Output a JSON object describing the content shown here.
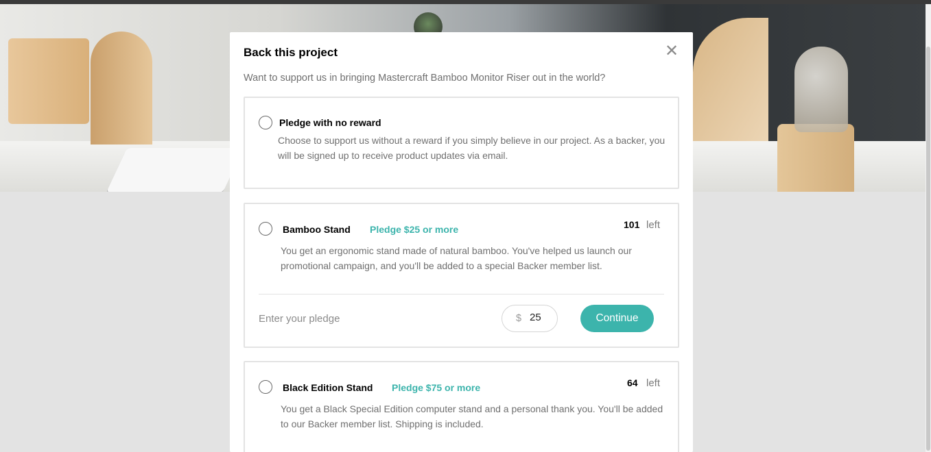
{
  "modal": {
    "title": "Back this project",
    "subtitle": "Want to support us in bringing Mastercraft Bamboo Monitor Riser out in the world?",
    "close_icon": "close-icon"
  },
  "rewards": [
    {
      "title": "Pledge with no reward",
      "description": "Choose to support us without a reward if you simply believe in our project. As a backer, you will be signed up to receive product updates via email.",
      "selected": false
    },
    {
      "title": "Bamboo Stand",
      "pledge_min": "Pledge $25 or more",
      "left_count": "101",
      "left_word": "left",
      "description": "You get an ergonomic stand made of natural bamboo. You've helped us launch our promotional campaign, and you'll be added to a special Backer member list.",
      "selected": false,
      "enter_label": "Enter your pledge",
      "currency": "$",
      "amount": "25",
      "continue_label": "Continue"
    },
    {
      "title": "Black Edition Stand",
      "pledge_min": "Pledge $75 or more",
      "left_count": "64",
      "left_word": "left",
      "description": "You get a Black Special Edition computer stand and a personal thank you. You'll be added to our Backer member list. Shipping is included.",
      "selected": false
    }
  ],
  "colors": {
    "accent": "#3cb4ac",
    "overlay": "#e3e3e3",
    "text_muted": "#6f6f6f"
  }
}
